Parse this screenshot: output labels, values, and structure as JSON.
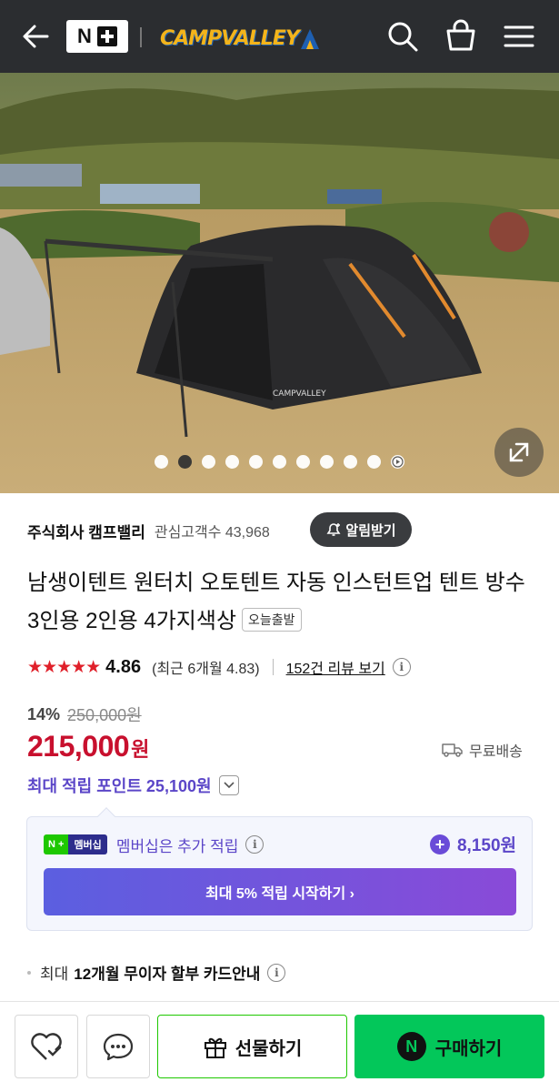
{
  "header": {
    "nplus_letter": "N",
    "brand": "CAMPVALLEY"
  },
  "hero": {
    "slide_count": 11,
    "active_slide": 2,
    "tent_logo_text": "CAMPVALLEY"
  },
  "seller": {
    "name": "주식회사 캠프밸리",
    "interest_label": "관심고객수 43,968",
    "notify_label": "알림받기"
  },
  "product": {
    "title": "남생이텐트 원터치 오토텐트 자동 인스턴트업 텐트 방수 3인용 2인용 4가지색상",
    "badge": "오늘출발"
  },
  "rating": {
    "stars": "★★★★★",
    "score": "4.86",
    "recent": "(최근 6개월 4.83)",
    "review_link": "152건 리뷰 보기"
  },
  "price": {
    "discount": "14%",
    "original": "250,000원",
    "current": "215,000",
    "unit": "원",
    "shipping": "무료배송",
    "points": "최대 적립 포인트 25,100원"
  },
  "membership": {
    "badge_left": "N +",
    "badge_right": "멤버십",
    "text": "멤버십은 추가 적립",
    "points": "8,150원",
    "button": "최대 5% 적립 시작하기 ›"
  },
  "install": {
    "prefix": "최대",
    "bold": "12개월 무이자 할부 카드안내"
  },
  "bottom_bar": {
    "gift_label": "선물하기",
    "buy_label": "구매하기",
    "buy_icon_letter": "N"
  },
  "colors": {
    "header_bg": "#2b2d30",
    "price_red": "#c8102e",
    "accent_purple": "#5b46c8",
    "naver_green": "#03c75a"
  }
}
